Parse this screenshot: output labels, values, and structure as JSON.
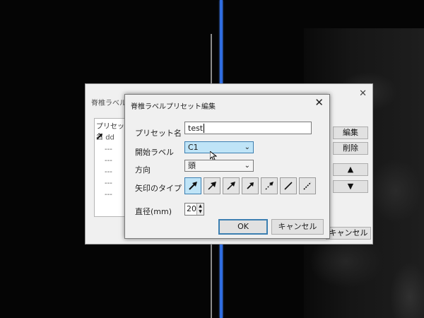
{
  "background": {
    "parent_title": "脊椎ラベルプリセ",
    "parent_close": "✕",
    "list_header": "プリセット名",
    "list_items": [
      "dd",
      "---",
      "---",
      "---",
      "---",
      "---"
    ],
    "edit_button": "編集",
    "delete_button": "削除",
    "up_button": "▲",
    "down_button": "▼",
    "cancel_button": "キャンセル"
  },
  "dialog": {
    "title": "脊椎ラベルプリセット編集",
    "close": "✕",
    "preset_name_label": "プリセット名",
    "preset_name_value": "test",
    "start_label_label": "開始ラベル",
    "start_label_value": "C1",
    "direction_label": "方向",
    "direction_value": "頭",
    "arrow_type_label": "矢印のタイプ",
    "arrow_types": [
      "arrow-solid",
      "arrow-filled-dashed",
      "arrow-filled",
      "arrow-filled-short",
      "arrow-dashed",
      "line-solid",
      "line-dashed"
    ],
    "selected_arrow_index": 0,
    "diameter_label": "直径(mm)",
    "diameter_value": "20",
    "ok_button": "OK",
    "cancel_button": "キャンセル"
  },
  "colors": {
    "accent": "#3c7fb1",
    "selected_bg": "#bfe4f7",
    "line_blue": "#2f6de0"
  }
}
